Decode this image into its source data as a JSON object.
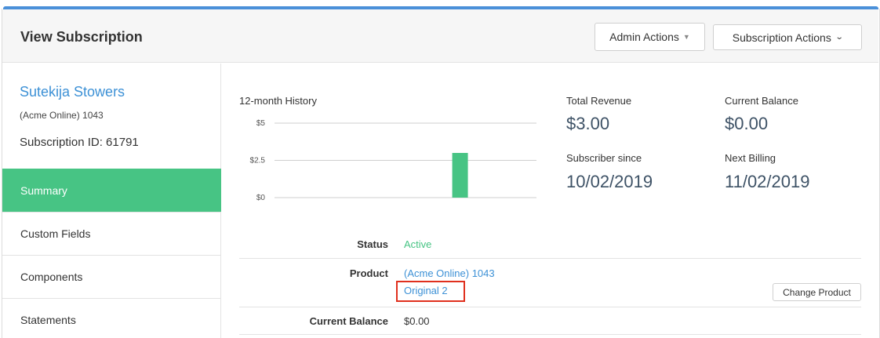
{
  "header": {
    "title": "View Subscription",
    "admin_actions": "Admin Actions",
    "subscription_actions": "Subscription Actions"
  },
  "customer": {
    "name": "Sutekija Stowers",
    "org": "(Acme Online) 1043",
    "subscription_id": "Subscription ID: 61791"
  },
  "nav": {
    "items": [
      {
        "label": "Summary",
        "active": true
      },
      {
        "label": "Custom Fields"
      },
      {
        "label": "Components"
      },
      {
        "label": "Statements"
      }
    ]
  },
  "chart_data": {
    "type": "bar",
    "title": "12-month History",
    "yticks": [
      "$5",
      "$2.5",
      "$0"
    ],
    "ylim": [
      0,
      5
    ],
    "values": [
      0,
      0,
      0,
      0,
      0,
      0,
      0,
      0,
      3,
      0,
      0,
      0
    ],
    "bar_color": "#47c484"
  },
  "stats": {
    "total_revenue_label": "Total Revenue",
    "total_revenue": "$3.00",
    "current_balance_label": "Current Balance",
    "current_balance": "$0.00",
    "subscriber_since_label": "Subscriber since",
    "subscriber_since": "10/02/2019",
    "next_billing_label": "Next Billing",
    "next_billing": "11/02/2019"
  },
  "details": {
    "status_label": "Status",
    "status_value": "Active",
    "product_label": "Product",
    "product_family": "(Acme Online) 1043",
    "product_name": "Original 2",
    "change_product": "Change Product",
    "balance_label": "Current Balance",
    "balance_value": "$0.00"
  },
  "colors": {
    "accent": "#47c484",
    "link": "#3d91d6",
    "top_bar": "#4a90d9",
    "highlight": "#e0301e"
  }
}
